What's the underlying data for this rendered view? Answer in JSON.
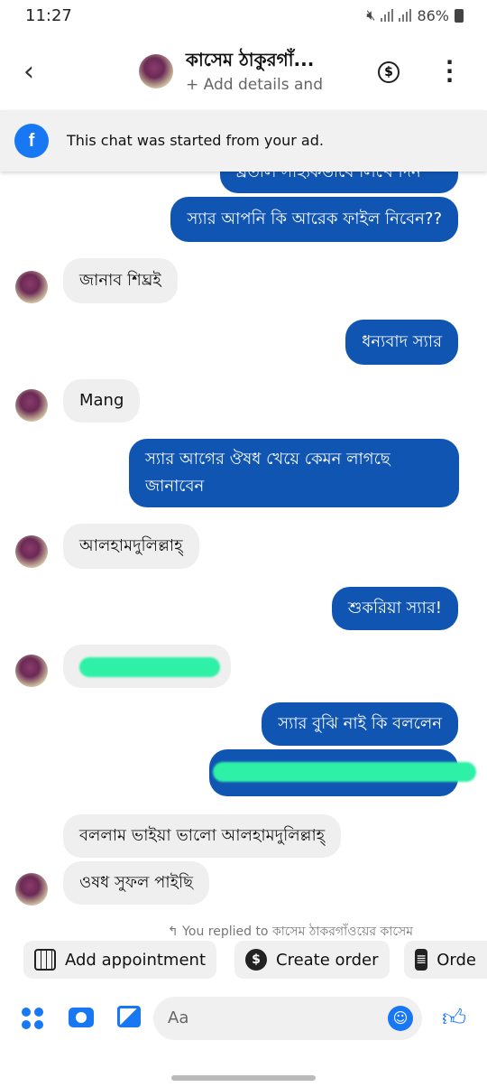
{
  "status_bar": {
    "time": "11:27",
    "battery": "86%"
  },
  "header": {
    "contact_name": "কাসেম ঠাকুরগাঁ...",
    "subtitle": "+ Add details and"
  },
  "banner": {
    "text": "This chat was started from your ad."
  },
  "messages": [
    {
      "id": "m0",
      "dir": "out",
      "text": "ধ্রতাল সাহ্যকভাবে লিখে দিন"
    },
    {
      "id": "m1",
      "dir": "out",
      "text": "স্যার আপনি কি আরেক ফাইল নিবেন??"
    },
    {
      "id": "m2",
      "dir": "in",
      "text": "জানাব শিঘ্রই"
    },
    {
      "id": "m3",
      "dir": "out",
      "text": "ধন্যবাদ স্যার"
    },
    {
      "id": "m4",
      "dir": "in",
      "text": "Mang"
    },
    {
      "id": "m5",
      "dir": "out",
      "lines": [
        "স্যার আগের ঔষধ খেয়ে কেমন লাগছে",
        "জানাবেন"
      ]
    },
    {
      "id": "m6",
      "dir": "in",
      "text": "আলহামদুলিল্লাহ্"
    },
    {
      "id": "m7",
      "dir": "out",
      "text": "শুকরিয়া স্যার!"
    },
    {
      "id": "m8",
      "dir": "in",
      "text": ""
    },
    {
      "id": "m9",
      "dir": "out",
      "text": "স্যার বুঝি নাই কি বললেন"
    },
    {
      "id": "m10",
      "dir": "out",
      "text": ""
    },
    {
      "id": "m11",
      "dir": "in",
      "text": "বললাম ভাইয়া ভালো আলহামদুলিল্লাহ্"
    },
    {
      "id": "m12",
      "dir": "in",
      "text": "ওষধ সুফল পাইছি"
    }
  ],
  "reply_note": "↰ You replied to কাসেম ঠাকরগাঁওয়ের কাসেম",
  "actions": {
    "appointment": "Add appointment",
    "order": "Create order",
    "orders": "Orde"
  },
  "composer": {
    "placeholder": "Aa"
  },
  "colors": {
    "accent": "#1877f2",
    "outgoing_bubble": "#1155b3",
    "incoming_bubble": "#efefef"
  }
}
